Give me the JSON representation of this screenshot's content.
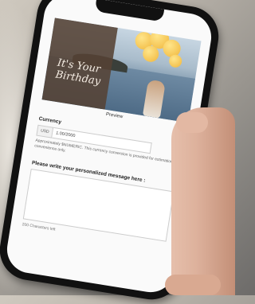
{
  "card": {
    "title": "It's Your Birthday",
    "side_text": "",
    "link_text": ""
  },
  "preview_label": "Preview",
  "currency": {
    "label": "Currency",
    "code": "USD",
    "amount": "1.00/2000",
    "note": "Approximately $NUMERIC. This currency conversion is provided for estimation convenience only."
  },
  "message": {
    "label": "Please write your personalized message here :",
    "placeholder": "",
    "char_count": "200 Characters left"
  },
  "colors": {
    "card_panel": "#554234",
    "screen_bg": "#fafafa",
    "phone_frame": "#111111"
  }
}
